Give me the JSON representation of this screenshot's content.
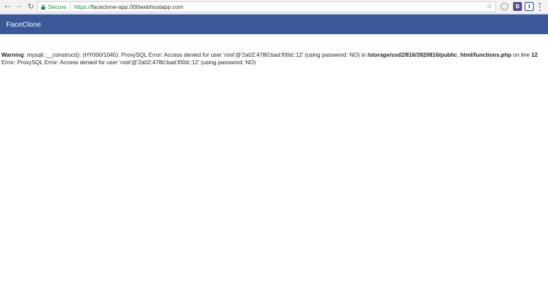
{
  "browser": {
    "secure_label": "Secure",
    "url_scheme": "https://",
    "url_host": "faceclone-app.000webhostapp.com",
    "extensions": {
      "b_label": "B",
      "i_label": "I"
    }
  },
  "site": {
    "brand": "FaceClone"
  },
  "error": {
    "warning_label": "Warning",
    "warning_text": ": mysqli::__construct(): (HY000/1045): ProxySQL Error: Access denied for user 'root'@'2a02:4780:bad:f00d::12' (using password: NO) in ",
    "file_path": "/storage/ssd2/816/3920816/public_html/functions.php",
    "on_line_text": " on line ",
    "line_number": "12",
    "second_line": "Error: ProxySQL Error: Access denied for user 'root'@'2a02:4780:bad:f00d::12' (using password: NO)"
  },
  "colors": {
    "navbar": "#3b5998",
    "secure_green": "#1e8e3e"
  }
}
